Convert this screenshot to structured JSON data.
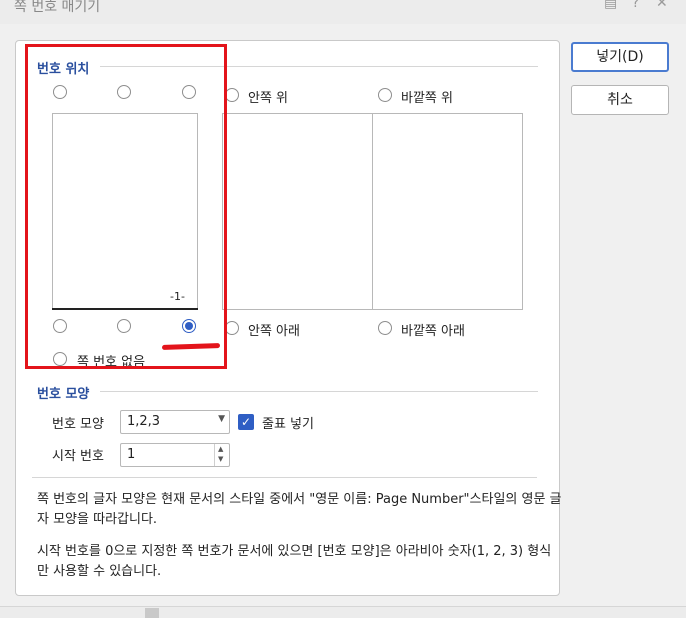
{
  "window": {
    "title": "쪽 번호 매기기",
    "help_icon": "?",
    "close_icon": "✕",
    "comment_icon": "▤"
  },
  "position_section": {
    "title": "번호 위치",
    "inner_top_label": "안쪽 위",
    "outer_top_label": "바깥쪽 위",
    "inner_bottom_label": "안쪽 아래",
    "outer_bottom_label": "바깥쪽 아래",
    "no_number_label": "쪽 번호 없음",
    "preview_page_number": "-1-",
    "selected": "bottom-right"
  },
  "shape_section": {
    "title": "번호 모양",
    "format_label": "번호 모양",
    "format_value": "1,2,3",
    "dash_checkbox_label": "줄표 넣기",
    "dash_checked": true,
    "start_label": "시작 번호",
    "start_value": "1"
  },
  "description": {
    "line1": "쪽 번호의 글자 모양은 현재 문서의 스타일 중에서 \"영문 이름: Page Number\"스타일의 영문 글자 모양을 따라갑니다.",
    "line2": "시작 번호를 0으로 지정한 쪽 번호가 문서에 있으면 [번호 모양]은 아라비아 숫자(1, 2, 3) 형식만 사용할 수 있습니다."
  },
  "buttons": {
    "insert_label": "넣기(D)",
    "cancel_label": "취소"
  },
  "colors": {
    "accent": "#2f5ec4",
    "section_title": "#2a4f9e",
    "highlight": "#e3141b"
  }
}
